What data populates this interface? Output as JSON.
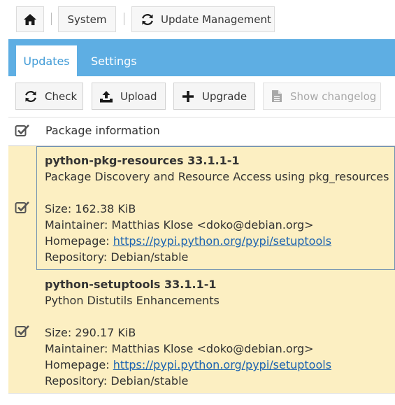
{
  "breadcrumb": {
    "home_icon": "home-icon",
    "items": [
      "System",
      "Update Management"
    ],
    "update_icon": "refresh-icon"
  },
  "tabs": [
    {
      "label": "Updates",
      "active": true
    },
    {
      "label": "Settings",
      "active": false
    }
  ],
  "toolbar": {
    "check": {
      "label": "Check",
      "icon": "refresh-icon"
    },
    "upload": {
      "label": "Upload",
      "icon": "upload-icon"
    },
    "upgrade": {
      "label": "Upgrade",
      "icon": "plus-icon"
    },
    "changelog": {
      "label": "Show changelog",
      "icon": "document-icon",
      "disabled": true
    }
  },
  "table": {
    "header": "Package information",
    "header_checked": true,
    "rows": [
      {
        "name": "python-pkg-resources 33.1.1-1",
        "description": "Package Discovery and Resource Access using pkg_resources",
        "size": "Size: 162.38 KiB",
        "maintainer": "Maintainer: Matthias Klose <doko@debian.org>",
        "homepage_label": "Homepage: ",
        "homepage_url": "https://pypi.python.org/pypi/setuptools",
        "repository": "Repository: Debian/stable",
        "checked": true,
        "focused": true
      },
      {
        "name": "python-setuptools 33.1.1-1",
        "description": "Python Distutils Enhancements",
        "size": "Size: 290.17 KiB",
        "maintainer": "Maintainer: Matthias Klose <doko@debian.org>",
        "homepage_label": "Homepage: ",
        "homepage_url": "https://pypi.python.org/pypi/setuptools",
        "repository": "Repository: Debian/stable",
        "checked": true,
        "focused": false
      }
    ]
  },
  "colors": {
    "tab_bar": "#5eaee3",
    "row_selected_bg": "#fcefc2",
    "link": "#1a62b0",
    "active_tab_text": "#3f9ad6"
  }
}
